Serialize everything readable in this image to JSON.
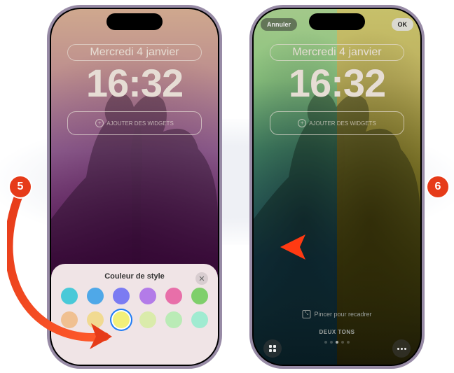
{
  "badges": {
    "step5": "5",
    "step6": "6"
  },
  "lock": {
    "date": "Mercredi 4 janvier",
    "time": "16:32",
    "add_widgets": "AJOUTER DES WIDGETS"
  },
  "sheet": {
    "title": "Couleur de style",
    "close": "✕",
    "row1_colors": [
      "#49c9d8",
      "#4fa8e8",
      "#7b7bf2",
      "#b37be8",
      "#e86fa9",
      "#7fcf6b"
    ],
    "row2_colors": [
      "#f0a24a",
      "#f2d24a",
      "#f2f07a",
      "#c8f07a",
      "#8ef08e",
      "#5ef0c0"
    ],
    "selected_idx": 2
  },
  "editor": {
    "cancel": "Annuler",
    "ok": "OK",
    "pinch": "Pincer pour recadrer",
    "style": "DEUX TONS",
    "pager_count": 5,
    "pager_active": 2
  },
  "colors": {
    "accent": "#e63b19",
    "selection_ring": "#1f7cf5"
  }
}
